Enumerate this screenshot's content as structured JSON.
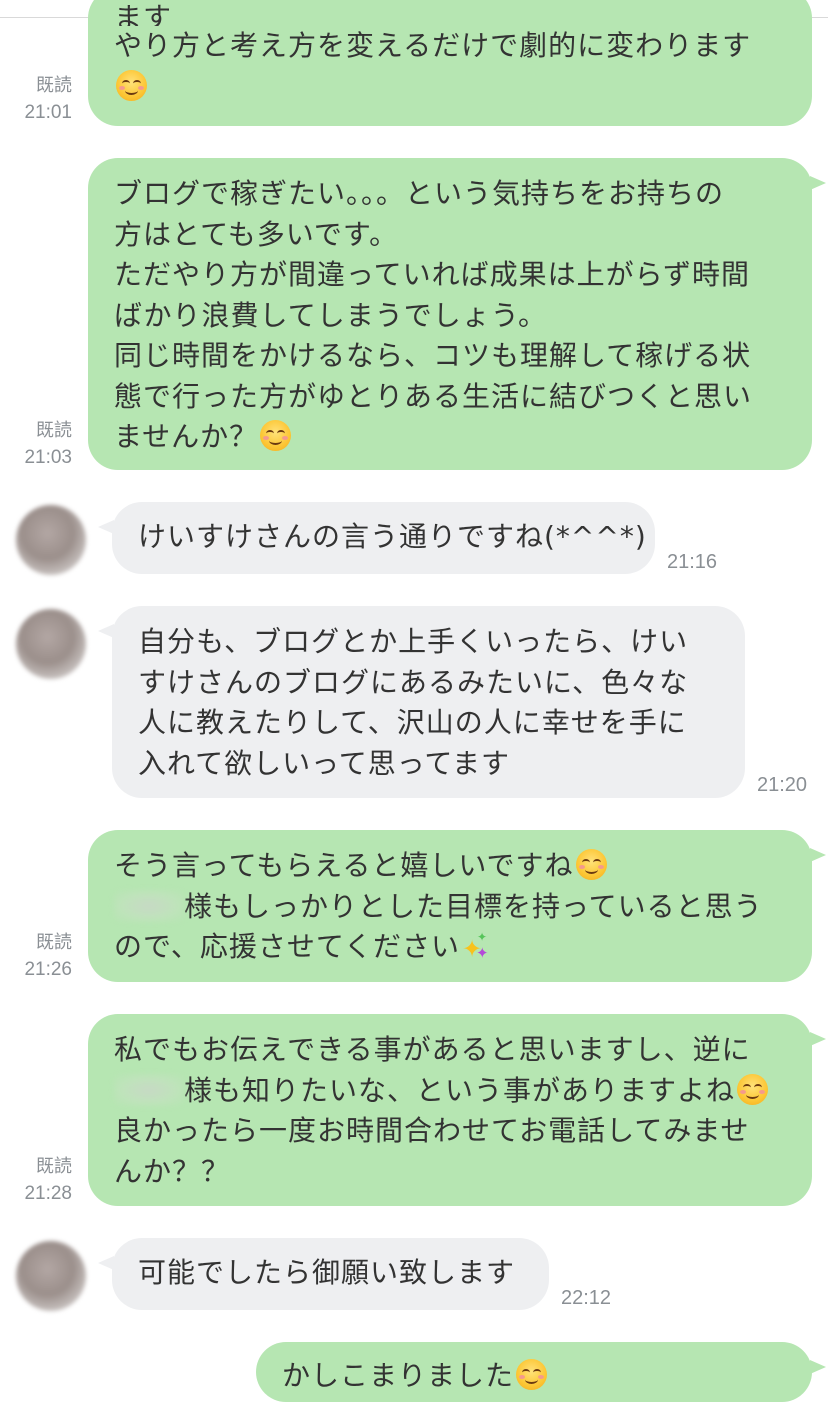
{
  "colors": {
    "outgoing_bubble": "#b6e6b2",
    "incoming_bubble": "#eeeff1",
    "meta_text": "#8a8f94"
  },
  "messages": [
    {
      "direction": "out",
      "partial_top": "ます",
      "lines": [
        "やり方と考え方を変えるだけで劇的に変わります"
      ],
      "emoji": "smiling-face",
      "read": "既読",
      "time": "21:01"
    },
    {
      "direction": "out",
      "lines": [
        "ブログで稼ぎたい。。。という気持ちをお持ちの",
        "方はとても多いです。",
        "ただやり方が間違っていれば成果は上がらず時間",
        "ばかり浪費してしまうでしょう。",
        "同じ時間をかけるなら、コツも理解して稼げる状",
        "態で行った方がゆとりある生活に結びつくと思い",
        "ませんか？"
      ],
      "emoji": "smiling-face",
      "read": "既読",
      "time": "21:03"
    },
    {
      "direction": "in",
      "lines": [
        "けいすけさんの言う通りですね(*^^*)"
      ],
      "time": "21:16"
    },
    {
      "direction": "in",
      "lines": [
        "自分も、ブログとか上手くいったら、けい",
        "すけさんのブログにあるみたいに、色々な",
        "人に教えたりして、沢山の人に幸せを手に",
        "入れて欲しいって思ってます"
      ],
      "time": "21:20"
    },
    {
      "direction": "out",
      "lines": [
        "そう言ってもらえると嬉しいですね",
        "様もしっかりとした目標を持っていると思う",
        "ので、応援させてください"
      ],
      "emoji": "smiling-face",
      "sparkle": "sparkles",
      "read": "既読",
      "time": "21:26"
    },
    {
      "direction": "out",
      "lines": [
        "私でもお伝えできる事があると思いますし、逆に",
        "様も知りたいな、という事がありますよね",
        "良かったら一度お時間合わせてお電話してみませ",
        "んか？？"
      ],
      "emoji": "smiling-face",
      "read": "既読",
      "time": "21:28"
    },
    {
      "direction": "in",
      "lines": [
        "可能でしたら御願い致します"
      ],
      "time": "22:12"
    },
    {
      "direction": "out",
      "lines": [
        "かしこまりました"
      ],
      "emoji": "smiling-face"
    }
  ]
}
